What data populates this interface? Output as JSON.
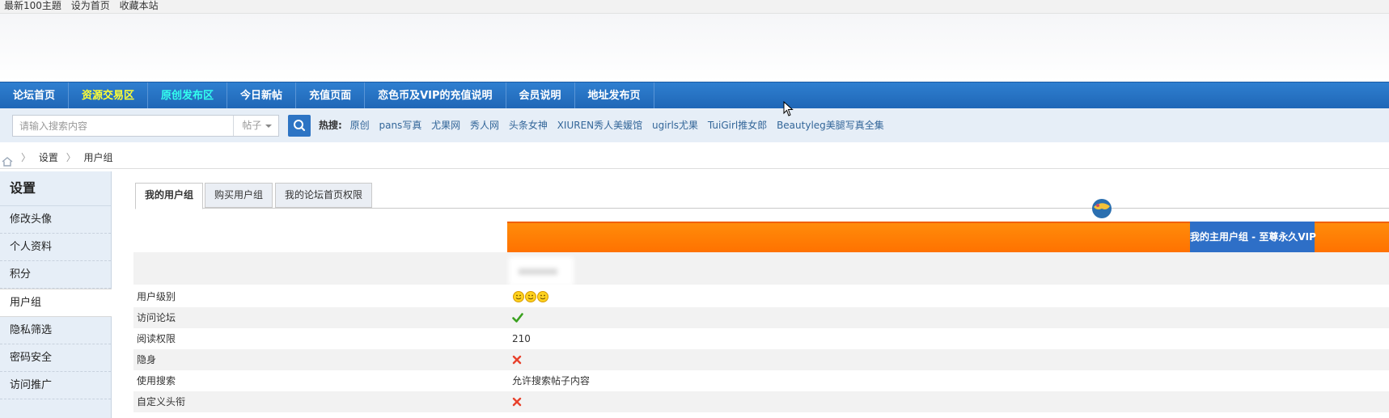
{
  "topbar": {
    "links": [
      "最新100主題",
      "设为首页",
      "收藏本站"
    ]
  },
  "nav": {
    "items": [
      "论坛首页",
      "资源交易区",
      "原创发布区",
      "今日新帖",
      "充值页面",
      "恋色币及VIP的充值说明",
      "会员说明",
      "地址发布页"
    ]
  },
  "search": {
    "placeholder": "请输入搜索内容",
    "type": "帖子",
    "hot_label": "热搜:",
    "hot_keywords": [
      "原创",
      "pans写真",
      "尤果网",
      "秀人网",
      "头条女神",
      "XIUREN秀人美媛馆",
      "ugirls尤果",
      "TuiGirl推女郎",
      "Beautyleg美腿写真全集"
    ]
  },
  "breadcrumb": {
    "items": [
      "设置",
      "用户组"
    ]
  },
  "sidebar": {
    "title": "设置",
    "items": [
      "修改头像",
      "个人资料",
      "积分",
      "用户组",
      "隐私筛选",
      "密码安全",
      "访问推广"
    ],
    "active_index": 3
  },
  "tabs": {
    "items": [
      "我的用户组",
      "购买用户组",
      "我的论坛首页权限"
    ]
  },
  "group": {
    "banner_label": "我的主用户组 - 至尊永久VIP",
    "rows": [
      {
        "label": "用户级别",
        "value": "",
        "icon": "smiley-rating-icon"
      },
      {
        "label": "访问论坛",
        "value": "",
        "icon": "check-icon"
      },
      {
        "label": "阅读权限",
        "value": "210"
      },
      {
        "label": "隐身",
        "value": "",
        "icon": "cross-icon"
      },
      {
        "label": "使用搜索",
        "value": "允许搜索帖子内容"
      },
      {
        "label": "自定义头衔",
        "value": "",
        "icon": "cross-icon"
      }
    ]
  },
  "colors": {
    "nav_bg": "#2f7fd0",
    "nav_highlight": "#ffff33",
    "nav_cyan": "#33ffee",
    "banner_orange": "#ff8000",
    "banner_label_bg": "#2e6fc7",
    "search_btn": "#2d74c4"
  }
}
